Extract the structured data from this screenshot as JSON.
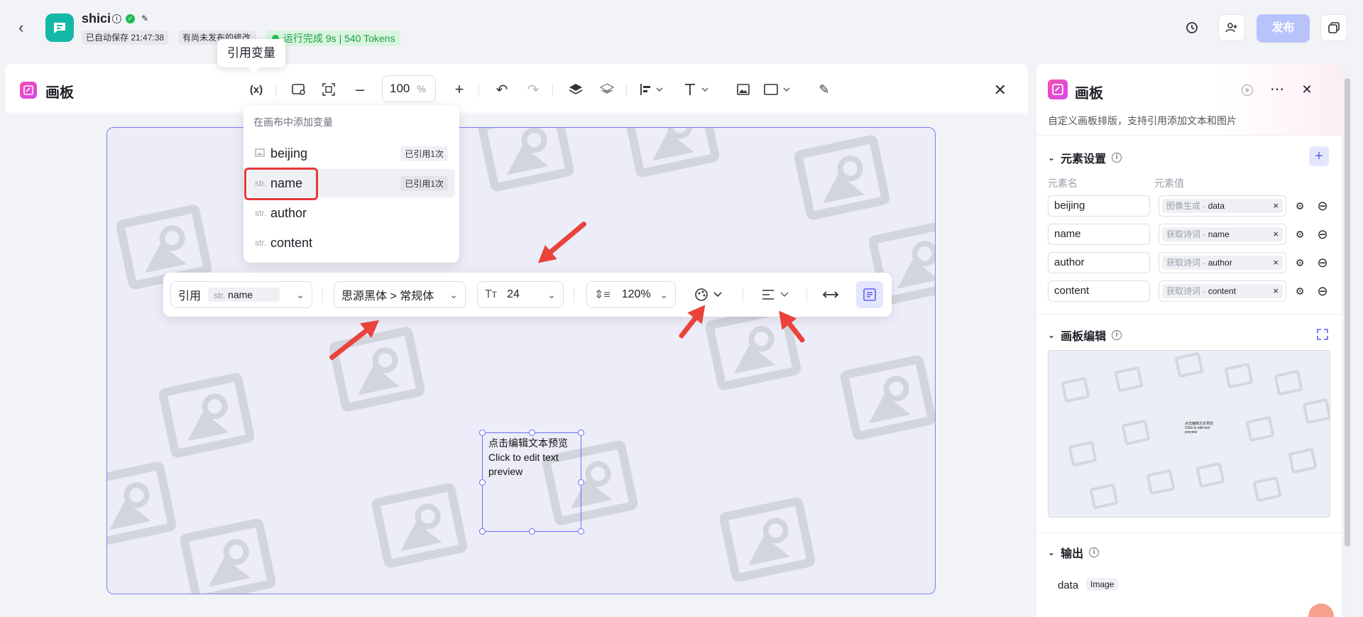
{
  "header": {
    "app_name": "shici",
    "autosave": "已自动保存 21:47:38",
    "unpublished": "有尚未发布的修改",
    "run_status": "运行完成 9s | 540 Tokens",
    "publish_label": "发布"
  },
  "toolbar": {
    "title": "画板",
    "zoom_value": "100",
    "zoom_unit": "%",
    "tooltip": "引用变量"
  },
  "var_menu": {
    "hint": "在画布中添加变量",
    "items": [
      {
        "type": "",
        "name": "beijing",
        "used": "已引用1次"
      },
      {
        "type": "str.",
        "name": "name",
        "used": "已引用1次"
      },
      {
        "type": "str.",
        "name": "author",
        "used": ""
      },
      {
        "type": "str.",
        "name": "content",
        "used": ""
      }
    ]
  },
  "text_toolbar": {
    "ref_label": "引用",
    "ref_type": "str.",
    "ref_value": "name",
    "font": "思源黑体 > 常规体",
    "font_size": "24",
    "line_height": "120%"
  },
  "textbox": {
    "line1": "点击编辑文本预览",
    "line2": "Click to edit text",
    "line3": "preview"
  },
  "side": {
    "title": "画板",
    "desc": "自定义画板排版，支持引用添加文本和图片",
    "elements_title": "元素设置",
    "col_name": "元素名",
    "col_value": "元素值",
    "elements": [
      {
        "name": "beijing",
        "src": "图像生成 -",
        "var": "data"
      },
      {
        "name": "name",
        "src": "获取诗词 -",
        "var": "name"
      },
      {
        "name": "author",
        "src": "获取诗词 -",
        "var": "author"
      },
      {
        "name": "content",
        "src": "获取诗词 -",
        "var": "content"
      }
    ],
    "board_edit_title": "画板编辑",
    "output_title": "输出",
    "output_var": "data",
    "output_type": "Image"
  },
  "colors": {
    "accent": "#6b6ff0",
    "publish": "#b9c3fb",
    "run_green": "#2bbf5b",
    "highlight": "#e5383b"
  }
}
